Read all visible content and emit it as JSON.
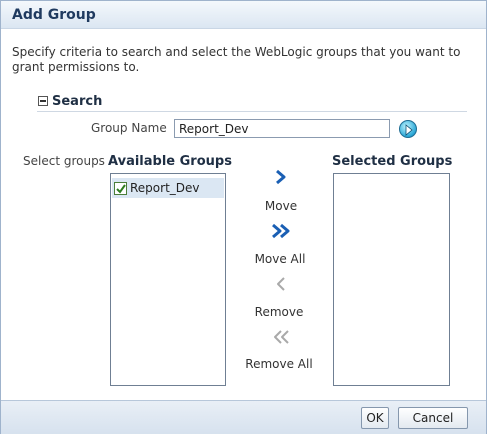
{
  "dialog": {
    "title": "Add Group",
    "description": "Specify criteria to search and select the WebLogic groups that you want to grant permissions to."
  },
  "search": {
    "title": "Search",
    "group_name_label": "Group Name",
    "group_name_value": "Report_Dev"
  },
  "shuttle": {
    "select_label": "Select groups",
    "available_title": "Available Groups",
    "selected_title": "Selected Groups",
    "available_items": [
      {
        "label": "Report_Dev",
        "checked": true
      }
    ],
    "selected_items": [],
    "move_label": "Move",
    "move_all_label": "Move All",
    "remove_label": "Remove",
    "remove_all_label": "Remove All"
  },
  "footer": {
    "ok_label": "OK",
    "cancel_label": "Cancel"
  },
  "colors": {
    "title_text": "#1f3a5f",
    "shuttle_active": "#1a5fb4",
    "shuttle_disabled": "#a9a9a9",
    "selection_bg": "#dbe7f3"
  }
}
